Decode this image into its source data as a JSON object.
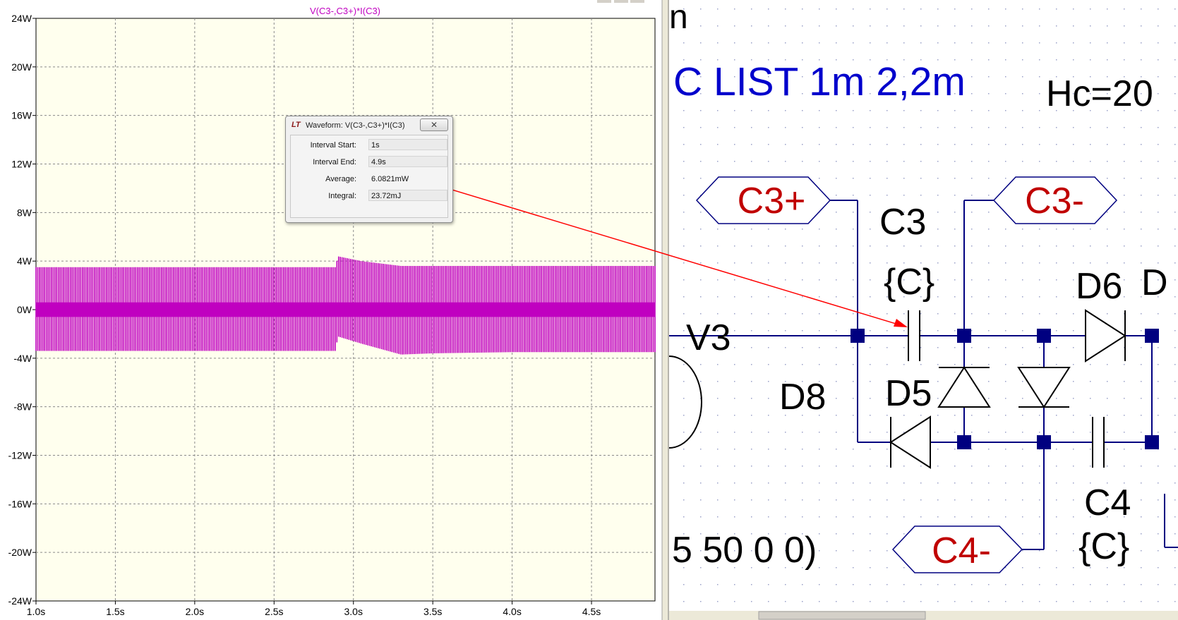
{
  "plot": {
    "trace_title": "V(C3-,C3+)*I(C3)",
    "trace_color": "#c000c0",
    "background_color": "#ffffee"
  },
  "chart_data": {
    "type": "line",
    "title": "V(C3-,C3+)*I(C3)",
    "xlabel": "",
    "ylabel": "",
    "xlim": [
      1.0,
      4.9
    ],
    "ylim": [
      -24,
      24
    ],
    "x_ticks": [
      "1.0s",
      "1.5s",
      "2.0s",
      "2.5s",
      "3.0s",
      "3.5s",
      "4.0s",
      "4.5s"
    ],
    "y_ticks": [
      "24W",
      "20W",
      "16W",
      "12W",
      "8W",
      "4W",
      "0W",
      "-4W",
      "-8W",
      "-12W",
      "-16W",
      "-20W",
      "-24W"
    ],
    "grid": true,
    "series": [
      {
        "name": "V(C3-,C3+)*I(C3)",
        "x": [
          1.0,
          2.89,
          2.9,
          3.05,
          3.3,
          3.5,
          4.0,
          4.9
        ],
        "ymax": [
          3.5,
          3.5,
          4.4,
          4.0,
          3.6,
          3.6,
          3.6,
          3.6
        ],
        "ymin": [
          -3.4,
          -3.4,
          -2.2,
          -2.8,
          -3.7,
          -3.6,
          -3.5,
          -3.5
        ]
      }
    ]
  },
  "dialog": {
    "title": "Waveform: V(C3-,C3+)*I(C3)",
    "logo": "LT",
    "close_glyph": "✕",
    "rows": [
      {
        "label": "Interval Start:",
        "value": "1s"
      },
      {
        "label": "Interval End:",
        "value": "4.9s"
      },
      {
        "label": "Average:",
        "value": "6.0821mW"
      },
      {
        "label": "Integral:",
        "value": "23.72mJ"
      }
    ]
  },
  "schematic": {
    "header_fragment": "n",
    "directive": "C LIST 1m 2,2m",
    "param": "Hc=20",
    "source_params": "5 50 0 0)",
    "labels": {
      "c3": "C3",
      "c3_value": "{C}",
      "c4": "C4",
      "c4_value": "{C}",
      "d5": "D5",
      "d6": "D6",
      "d8": "D8",
      "d_partial": "D",
      "v3": "V3"
    },
    "net_labels": {
      "c3_plus": "C3+",
      "c3_minus": "C3-",
      "c4_minus": "C4-"
    },
    "colors": {
      "wire": "#000080",
      "component": "#000000",
      "net_text": "#c00000",
      "directive": "#0000cc",
      "annotation": "#ff0000"
    }
  }
}
